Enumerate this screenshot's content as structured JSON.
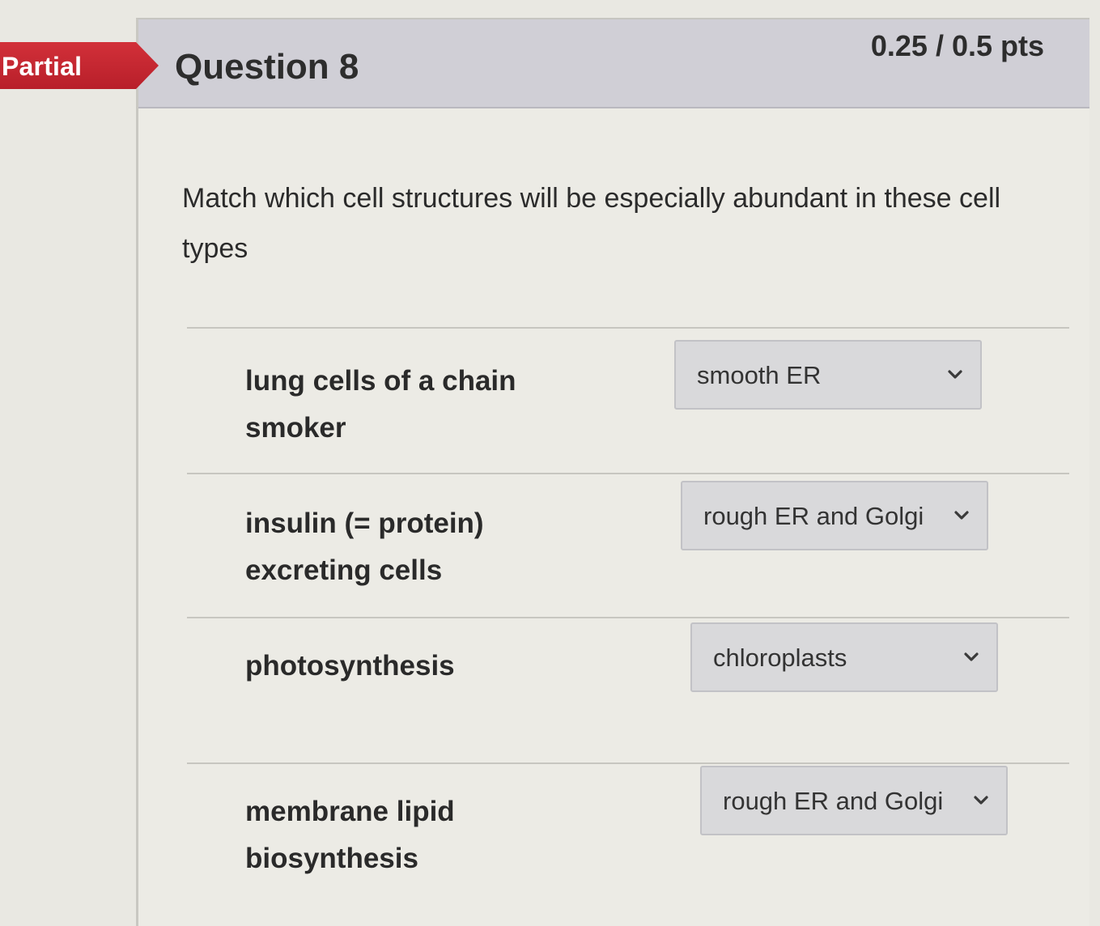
{
  "badge": {
    "label": "Partial",
    "color": "#c92631"
  },
  "question": {
    "title": "Question 8",
    "points": "0.25 / 0.5 pts",
    "prompt": "Match which cell structures will be especially abundant in these cell types"
  },
  "matches": [
    {
      "label": "lung cells of a chain smoker",
      "selected": "smooth ER"
    },
    {
      "label": "insulin (= protein) excreting cells",
      "selected": "rough ER and Golgi"
    },
    {
      "label": "photosynthesis",
      "selected": "chloroplasts"
    },
    {
      "label": "membrane lipid biosynthesis",
      "selected": "rough ER and Golgi"
    }
  ],
  "icons": {
    "dropdown": "chevron-down-icon"
  }
}
